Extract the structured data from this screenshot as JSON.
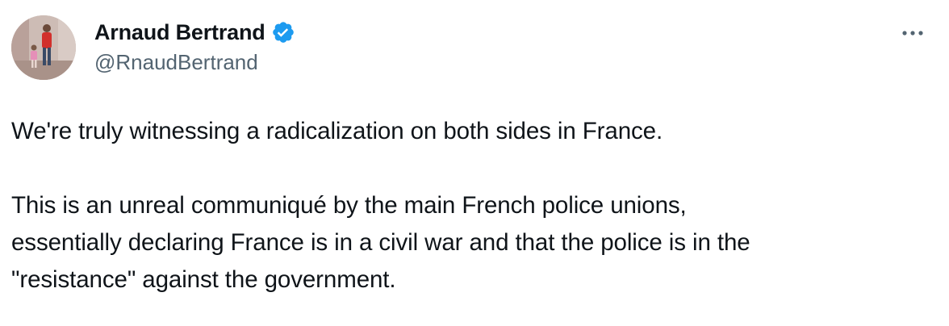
{
  "author": {
    "display_name": "Arnaud Bertrand",
    "handle": "@RnaudBertrand",
    "verified": true,
    "avatar_icon": "profile-photo",
    "verified_icon": "verified-badge-icon",
    "verified_color": "#1d9bf0"
  },
  "menu": {
    "icon": "more-options-icon"
  },
  "tweet": {
    "paragraph_1": "We're truly witnessing a radicalization on both sides in France.",
    "paragraph_2_line_1": "This is an unreal communiqué by the main French police unions,",
    "paragraph_2_line_2": "essentially declaring France is in a civil war and that the police is in the",
    "paragraph_2_line_3": "\"resistance\" against the government."
  },
  "colors": {
    "text_primary": "#0f1419",
    "text_secondary": "#536471",
    "accent": "#1d9bf0"
  }
}
